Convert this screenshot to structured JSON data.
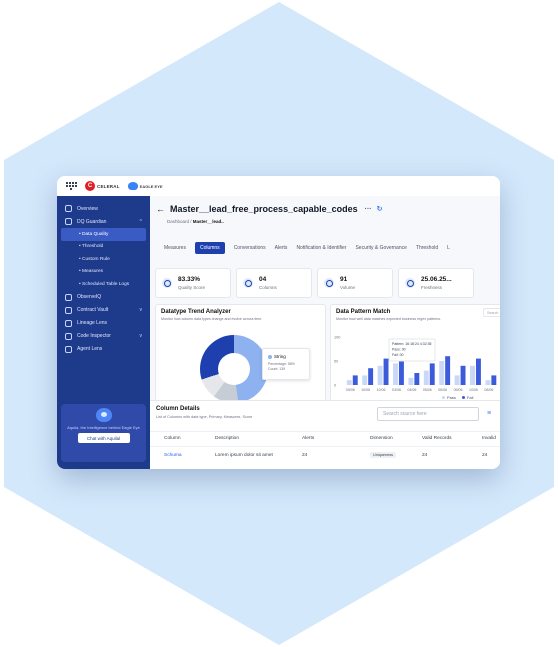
{
  "brand": {
    "logo1_text": "CELERAL",
    "logo2_text": "EAGLE EYE"
  },
  "sidebar": {
    "items": [
      {
        "label": "Overview",
        "icon": "home-icon"
      },
      {
        "label": "DQ Guardian",
        "icon": "shield-icon",
        "chev": "^"
      },
      {
        "label": "ObserveIQ",
        "icon": "eye-icon"
      },
      {
        "label": "Contract Vault",
        "icon": "vault-icon",
        "chev": "v"
      },
      {
        "label": "Lineage Lens",
        "icon": "lineage-icon"
      },
      {
        "label": "Code Inspector",
        "icon": "code-icon",
        "chev": "v"
      },
      {
        "label": "Agent Lens",
        "icon": "agent-icon"
      }
    ],
    "subitems": [
      "• Data Quality",
      "• Threshold",
      "• Custom Rule",
      "• Measures",
      "• Scheduled Table Logs"
    ],
    "promo": {
      "text": "Aquila, the Intelligence behind Eagle Eye",
      "button": "Chat with Aquilal"
    }
  },
  "header": {
    "title": "Master__lead_free_process_capable_codes",
    "more": "···",
    "refresh": "↻",
    "back": "←"
  },
  "breadcrumb": {
    "root": "Dashboard",
    "sep": " / ",
    "current": "Master__lead.."
  },
  "tabs": [
    "Measures",
    "Columns",
    "Conversations",
    "Alerts",
    "Notification & Identifier",
    "Security & Governance",
    "Threshold",
    "L"
  ],
  "active_tab": "Columns",
  "stats": [
    {
      "value": "83.33%",
      "label": "Quality Score"
    },
    {
      "value": "04",
      "label": "Columns"
    },
    {
      "value": "91",
      "label": "Volume"
    },
    {
      "value": "25.06.25...",
      "label": "Freshness"
    }
  ],
  "trend": {
    "title": "Datatype Trend Analyzer",
    "subtitle": "Monitor how column data types change and evolve across time.",
    "tooltip": {
      "label": "String",
      "line1": "Percentage: 58%",
      "line2": "Count: 139"
    }
  },
  "pattern": {
    "title": "Data Pattern Match",
    "subtitle": "Monitor how well data matches expected business regex patterns.",
    "search": "Search",
    "tooltip": {
      "line1": "Pattern: 16:18:24 4:32:35",
      "line2": "Pass: 00",
      "line3": "Fail: 00"
    },
    "legend": {
      "pass": "Pass",
      "fail": "Fail"
    }
  },
  "chart_data": {
    "type": "bar",
    "title": "Data Pattern Match",
    "categories": [
      "09/06",
      "10/06",
      "12/06",
      "03/06",
      "04/06",
      "05/06",
      "06/06",
      "09/06",
      "10/06",
      "08/06"
    ],
    "series": [
      {
        "name": "Pass",
        "values": [
          10,
          20,
          40,
          45,
          15,
          30,
          50,
          20,
          40,
          10
        ]
      },
      {
        "name": "Fail",
        "values": [
          20,
          35,
          55,
          60,
          25,
          45,
          60,
          40,
          55,
          20
        ]
      }
    ],
    "yticks": [
      100,
      50,
      0
    ],
    "ylim": [
      0,
      100
    ],
    "colors": {
      "pass": "#c9d8f7",
      "fail": "#3b5bdb"
    }
  },
  "table": {
    "title": "Column Details",
    "subtitle": "List of Columns with data type, Primary, Measures, Score",
    "search_placeholder": "Search source here",
    "headers": [
      "Column",
      "Description",
      "Alerts",
      "Dimension",
      "Valid Records",
      "Invalid"
    ],
    "rows": [
      {
        "column": "Schuma",
        "description": "Lorem ipsum dolor sit amet",
        "alerts": "24",
        "dimension": "Uniqueness",
        "valid": "24",
        "invalid": "24"
      }
    ]
  }
}
